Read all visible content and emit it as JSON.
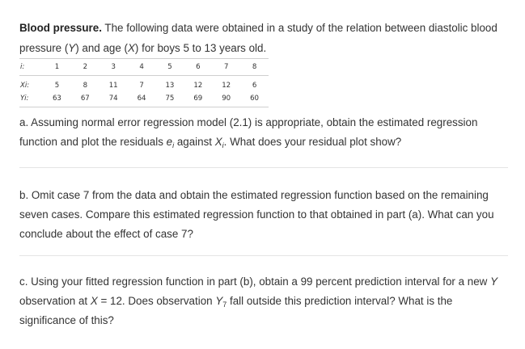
{
  "intro": {
    "title": "Blood pressure.",
    "text_1": " The following data were obtained in a study of the relation between diastolic blood pressure (",
    "y_sym": "Y",
    "text_2": ") and age (",
    "x_sym": "X",
    "text_3": ") for boys 5 to 13 years old."
  },
  "table": {
    "labels": [
      "i:",
      "Xi:",
      "Yi:"
    ],
    "i": [
      "1",
      "2",
      "3",
      "4",
      "5",
      "6",
      "7",
      "8"
    ],
    "x": [
      "5",
      "8",
      "11",
      "7",
      "13",
      "12",
      "12",
      "6"
    ],
    "y": [
      "63",
      "67",
      "74",
      "64",
      "75",
      "69",
      "90",
      "60"
    ]
  },
  "part_a": {
    "t1": "a. Assuming normal error regression model (2.1) is appropriate, obtain the estimated regression function and plot the residuals ",
    "e": "e",
    "sub_i1": "i",
    "t2": " against ",
    "X": "X",
    "sub_i2": "i",
    "t3": ". What does your residual plot show?"
  },
  "part_b": {
    "text": "b. Omit case 7 from the data and obtain the estimated regression function based on the remaining seven cases. Compare this estimated regression function to that obtained in part (a). What can you conclude about the effect of case 7?"
  },
  "part_c": {
    "t1": "c. Using your fitted regression function in part (b), obtain a 99 percent prediction interval for a new ",
    "Y": "Y",
    "t2": " observation at ",
    "X": "X",
    "t3": " = 12. Does observation ",
    "Y7": "Y",
    "sub7": "7",
    "t4": " fall outside this prediction interval? What is the significance of this?"
  }
}
